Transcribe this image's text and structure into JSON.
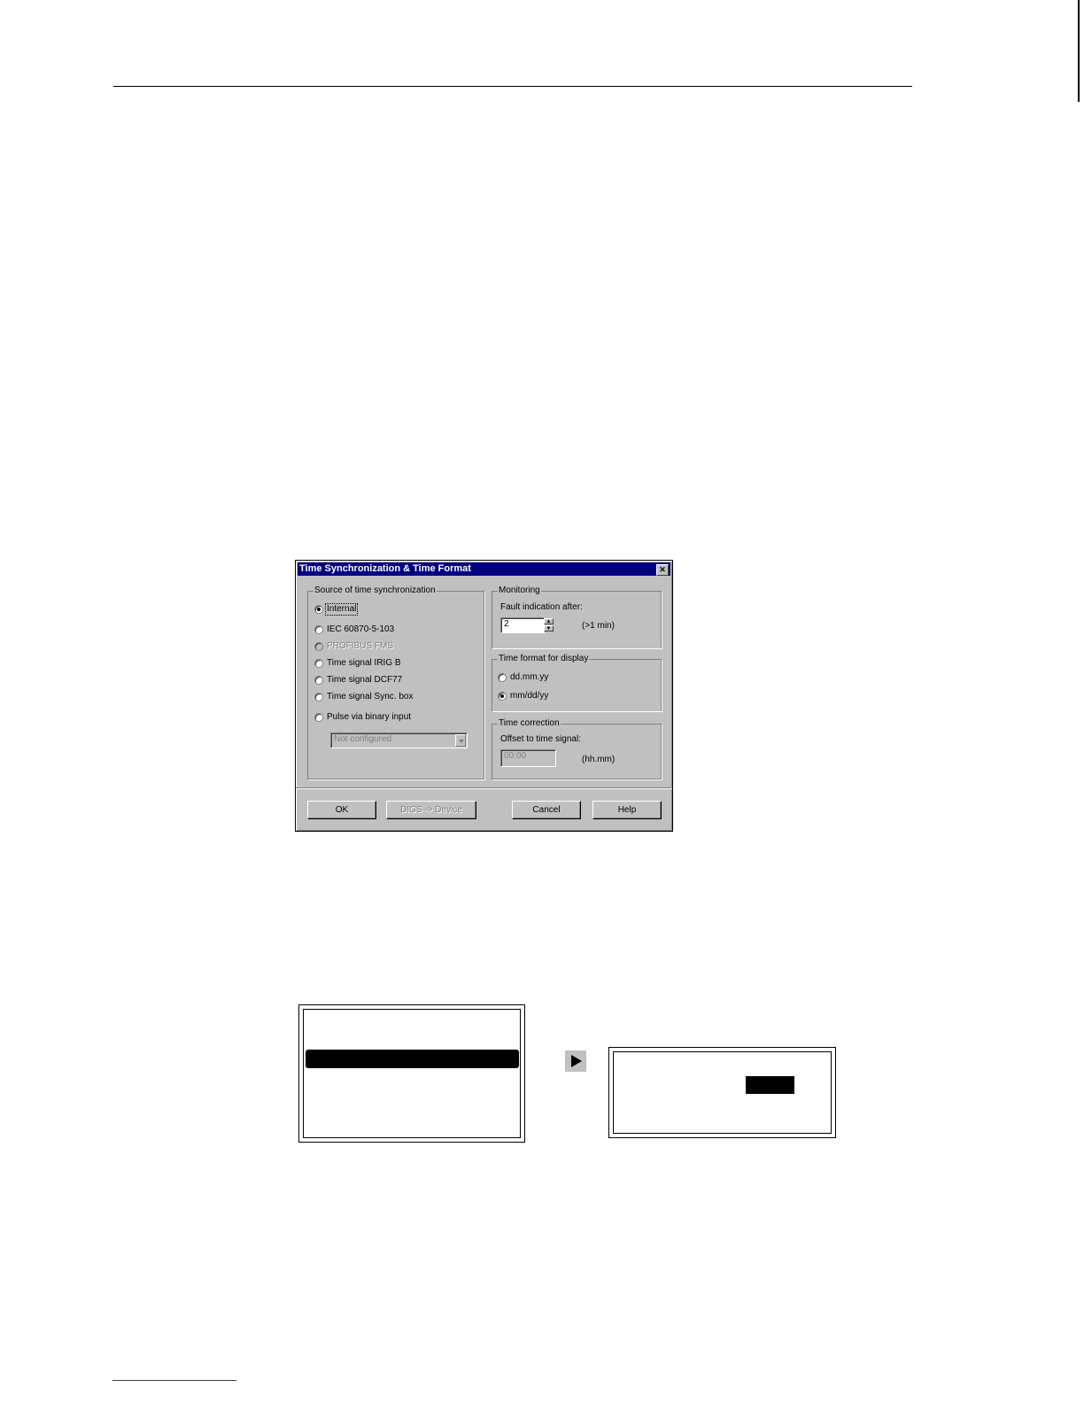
{
  "dialog": {
    "title": "Time Synchronization & Time Format",
    "close_glyph": "✕",
    "source_group": {
      "label": "Source of time synchronization",
      "options": [
        {
          "label": "Internal",
          "selected": true,
          "enabled": true
        },
        {
          "label": "IEC 60870-5-103",
          "selected": false,
          "enabled": true
        },
        {
          "label": "PROFIBUS FMS",
          "selected": false,
          "enabled": false
        },
        {
          "label": "Time signal IRIG B",
          "selected": false,
          "enabled": true
        },
        {
          "label": "Time signal DCF77",
          "selected": false,
          "enabled": true
        },
        {
          "label": "Time signal Sync. box",
          "selected": false,
          "enabled": true
        },
        {
          "label": "Pulse via binary input",
          "selected": false,
          "enabled": true
        }
      ],
      "binary_input_select": "Not configured"
    },
    "monitoring_group": {
      "label": "Monitoring",
      "fault_label": "Fault indication after:",
      "fault_value": "2",
      "fault_unit": "(>1 min)"
    },
    "time_format_group": {
      "label": "Time format for display",
      "options": [
        {
          "label": "dd.mm.yy",
          "selected": false
        },
        {
          "label": "mm/dd/yy",
          "selected": true
        }
      ]
    },
    "time_correction_group": {
      "label": "Time correction",
      "offset_label": "Offset to time signal:",
      "offset_value": "00:00",
      "offset_unit": "(hh.mm)"
    },
    "buttons": {
      "ok": "OK",
      "digs_device": "DIGS -> Device",
      "cancel": "Cancel",
      "help": "Help"
    }
  }
}
